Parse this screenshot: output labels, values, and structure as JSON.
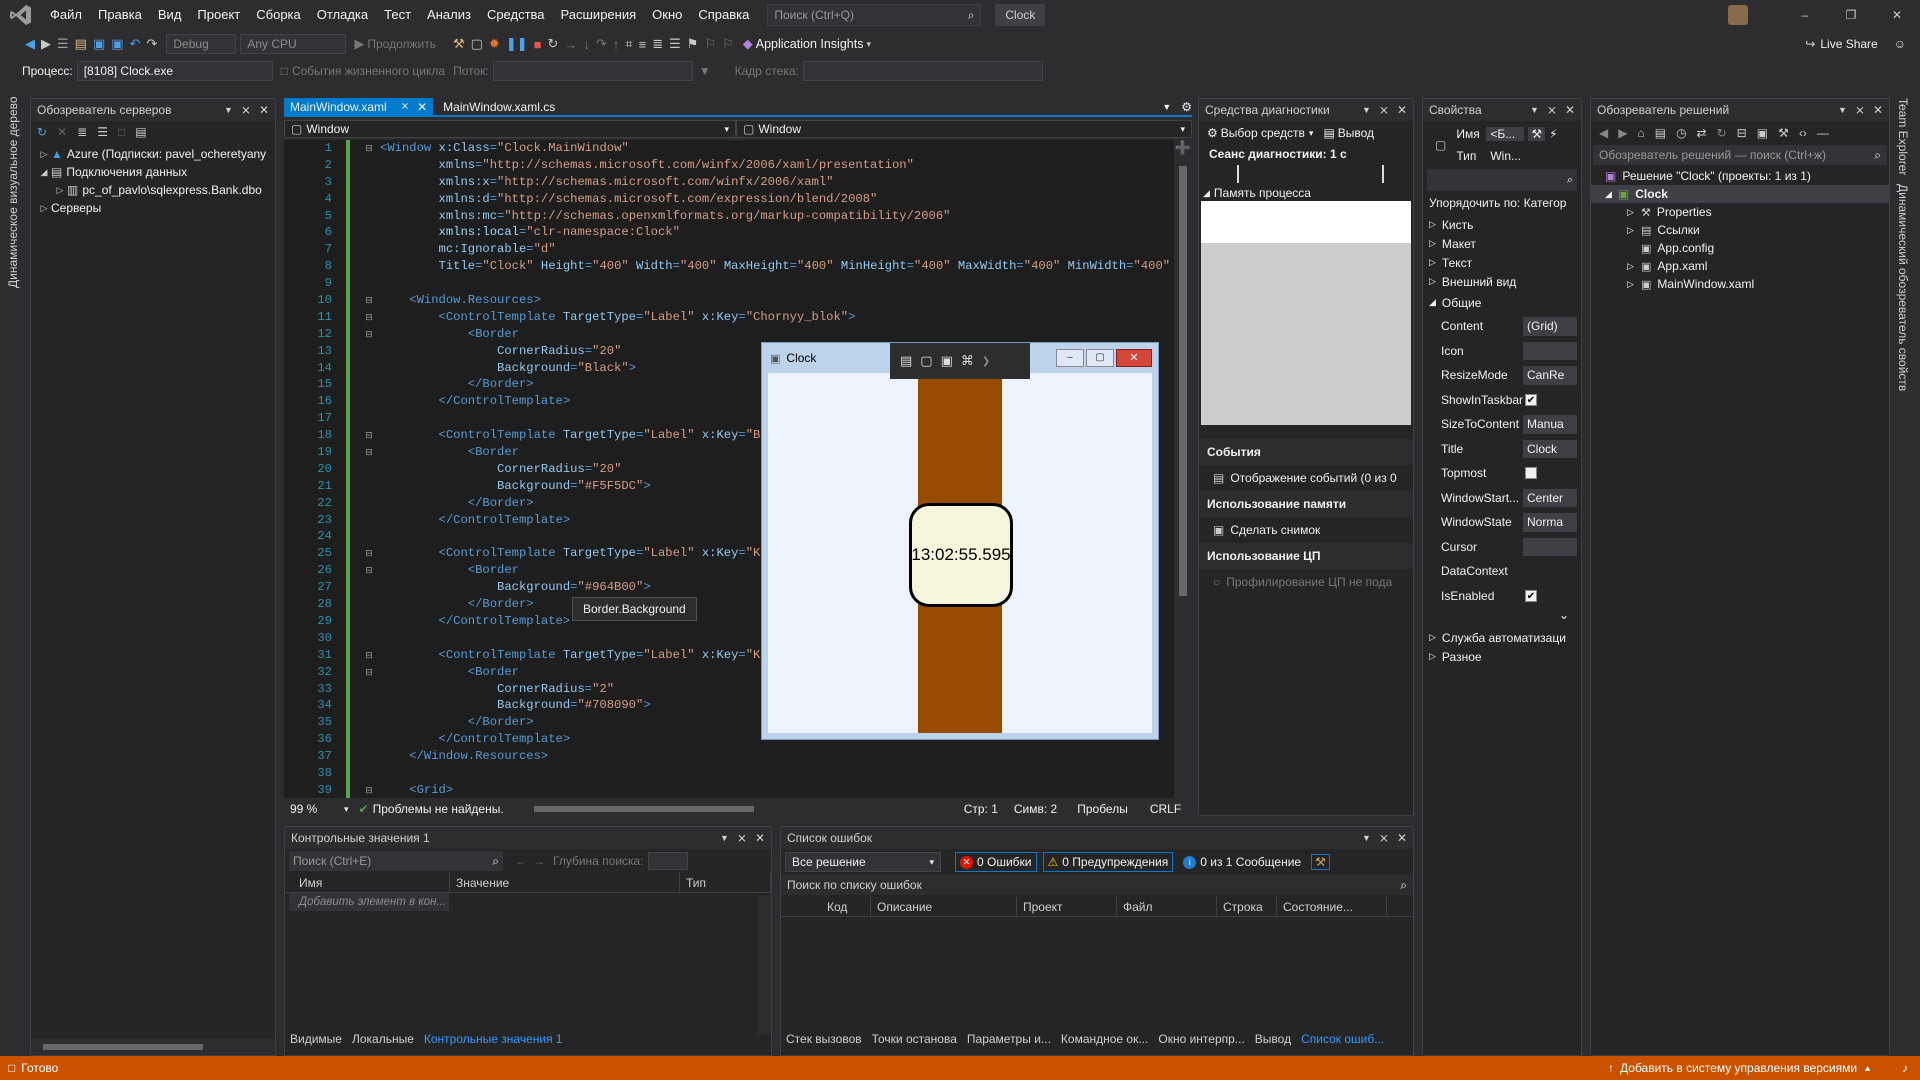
{
  "menu": [
    "Файл",
    "Правка",
    "Вид",
    "Проект",
    "Сборка",
    "Отладка",
    "Тест",
    "Анализ",
    "Средства",
    "Расширения",
    "Окно",
    "Справка"
  ],
  "search_placeholder": "Поиск (Ctrl+Q)",
  "solution_title": "Clock",
  "toolbar": {
    "config": "Debug",
    "platform": "Any CPU",
    "continue": "Продолжить",
    "app_insights": "Application Insights",
    "live_share": "Live Share"
  },
  "debug_bar": {
    "process_label": "Процесс:",
    "process_value": "[8108] Clock.exe",
    "lifecycle": "События жизненного цикла",
    "thread_label": "Поток:",
    "stack_label": "Кадр стека:"
  },
  "left_strip": "Динамическое визуальное дерево",
  "right_strip1": "Team Explorer",
  "right_strip2": "Динамический обозреватель свойств",
  "server_explorer": {
    "title": "Обозреватель серверов",
    "items": [
      {
        "label": "Azure (Подписки: pavel_ocheretyany"
      },
      {
        "label": "Подключения данных"
      },
      {
        "label": "pc_of_pavlo\\sqlexpress.Bank.dbo"
      },
      {
        "label": "Серверы"
      }
    ]
  },
  "editor": {
    "tabs": [
      "MainWindow.xaml",
      "MainWindow.xaml.cs"
    ],
    "nav_left": "Window",
    "nav_right": "Window",
    "zoom": "99 %",
    "no_issues": "Проблемы не найдены.",
    "line": "Стр: 1",
    "col": "Симв: 2",
    "spaces": "Пробелы",
    "crlf": "CRLF",
    "tooltip": "Border.Background"
  },
  "code_lines": [
    [
      [
        "tag",
        "<Window"
      ],
      [
        "attr",
        " x:Class"
      ],
      [
        "tag",
        "="
      ],
      [
        "str",
        "\"Clock.MainWindow\""
      ]
    ],
    [
      [
        "attr",
        "        xmlns"
      ],
      [
        "tag",
        "="
      ],
      [
        "str",
        "\"http://schemas.microsoft.com/winfx/2006/xaml/presentation\""
      ]
    ],
    [
      [
        "attr",
        "        xmlns:x"
      ],
      [
        "tag",
        "="
      ],
      [
        "str",
        "\"http://schemas.microsoft.com/winfx/2006/xaml\""
      ]
    ],
    [
      [
        "attr",
        "        xmlns:d"
      ],
      [
        "tag",
        "="
      ],
      [
        "str",
        "\"http://schemas.microsoft.com/expression/blend/2008\""
      ]
    ],
    [
      [
        "attr",
        "        xmlns:mc"
      ],
      [
        "tag",
        "="
      ],
      [
        "str",
        "\"http://schemas.openxmlformats.org/markup-compatibility/2006\""
      ]
    ],
    [
      [
        "xmlns",
        "        xmlns:local"
      ],
      [
        "tag",
        "="
      ],
      [
        "str",
        "\"clr-namespace:Clock\""
      ]
    ],
    [
      [
        "attr",
        "        mc:Ignorable"
      ],
      [
        "tag",
        "="
      ],
      [
        "str",
        "\"d\""
      ]
    ],
    [
      [
        "attr",
        "        Title"
      ],
      [
        "tag",
        "="
      ],
      [
        "str",
        "\"Clock\""
      ],
      [
        "attr",
        " Height"
      ],
      [
        "tag",
        "="
      ],
      [
        "str",
        "\"400\""
      ],
      [
        "attr",
        " Width"
      ],
      [
        "tag",
        "="
      ],
      [
        "str",
        "\"400\""
      ],
      [
        "attr",
        " MaxHeight"
      ],
      [
        "tag",
        "="
      ],
      [
        "str",
        "\"400\""
      ],
      [
        "attr",
        " MinHeight"
      ],
      [
        "tag",
        "="
      ],
      [
        "str",
        "\"400\""
      ],
      [
        "attr",
        " MaxWidth"
      ],
      [
        "tag",
        "="
      ],
      [
        "str",
        "\"400\""
      ],
      [
        "attr",
        " MinWidth"
      ],
      [
        "tag",
        "="
      ],
      [
        "str",
        "\"400\""
      ],
      [
        "attr",
        " Winc"
      ]
    ],
    [],
    [
      [
        "tag",
        "    <Window.Resources>"
      ]
    ],
    [
      [
        "tag",
        "        <ControlTemplate"
      ],
      [
        "attr",
        " TargetType"
      ],
      [
        "tag",
        "="
      ],
      [
        "str",
        "\"Label\""
      ],
      [
        "attr",
        " x:Key"
      ],
      [
        "tag",
        "="
      ],
      [
        "str",
        "\"Chornyy_blok\""
      ],
      [
        "tag",
        ">"
      ]
    ],
    [
      [
        "tag",
        "            <Border"
      ]
    ],
    [
      [
        "attr",
        "                CornerRadius"
      ],
      [
        "tag",
        "="
      ],
      [
        "str",
        "\"20\""
      ]
    ],
    [
      [
        "attr",
        "                Background"
      ],
      [
        "tag",
        "="
      ],
      [
        "str",
        "\"Black\""
      ],
      [
        "tag",
        ">"
      ]
    ],
    [
      [
        "tag",
        "            </Border>"
      ]
    ],
    [
      [
        "tag",
        "        </ControlTemplate>"
      ]
    ],
    [],
    [
      [
        "tag",
        "        <ControlTemplate"
      ],
      [
        "attr",
        " TargetType"
      ],
      [
        "tag",
        "="
      ],
      [
        "str",
        "\"Label\""
      ],
      [
        "attr",
        " x:Key"
      ],
      [
        "tag",
        "="
      ],
      [
        "str",
        "\"Bely"
      ]
    ],
    [
      [
        "tag",
        "            <Border"
      ]
    ],
    [
      [
        "attr",
        "                CornerRadius"
      ],
      [
        "tag",
        "="
      ],
      [
        "str",
        "\"20\""
      ]
    ],
    [
      [
        "attr",
        "                Background"
      ],
      [
        "tag",
        "="
      ],
      [
        "str",
        "\"#F5F5DC\""
      ],
      [
        "tag",
        ">"
      ]
    ],
    [
      [
        "tag",
        "            </Border>"
      ]
    ],
    [
      [
        "tag",
        "        </ControlTemplate>"
      ]
    ],
    [],
    [
      [
        "tag",
        "        <ControlTemplate"
      ],
      [
        "attr",
        " TargetType"
      ],
      [
        "tag",
        "="
      ],
      [
        "str",
        "\"Label\""
      ],
      [
        "attr",
        " x:Key"
      ],
      [
        "tag",
        "="
      ],
      [
        "str",
        "\"Kor:"
      ]
    ],
    [
      [
        "tag",
        "            <Border"
      ]
    ],
    [
      [
        "attr",
        "                Background"
      ],
      [
        "tag",
        "="
      ],
      [
        "str",
        "\"#964B00\""
      ],
      [
        "tag",
        ">"
      ]
    ],
    [
      [
        "tag",
        "            </Border>"
      ]
    ],
    [
      [
        "tag",
        "        </ControlTemplate>"
      ]
    ],
    [],
    [
      [
        "tag",
        "        <ControlTemplate"
      ],
      [
        "attr",
        " TargetType"
      ],
      [
        "tag",
        "="
      ],
      [
        "str",
        "\"Label\""
      ],
      [
        "attr",
        " x:Key"
      ],
      [
        "tag",
        "="
      ],
      [
        "str",
        "\"Knop"
      ]
    ],
    [
      [
        "tag",
        "            <Border"
      ]
    ],
    [
      [
        "attr",
        "                CornerRadius"
      ],
      [
        "tag",
        "="
      ],
      [
        "str",
        "\"2\""
      ]
    ],
    [
      [
        "attr",
        "                Background"
      ],
      [
        "tag",
        "="
      ],
      [
        "str",
        "\"#708090\""
      ],
      [
        "tag",
        ">"
      ]
    ],
    [
      [
        "tag",
        "            </Border>"
      ]
    ],
    [
      [
        "tag",
        "        </ControlTemplate>"
      ]
    ],
    [
      [
        "tag",
        "    </Window.Resources>"
      ]
    ],
    [],
    [
      [
        "tag",
        "    <Grid>"
      ]
    ]
  ],
  "line_numbers": [
    "1",
    "2",
    "3",
    "4",
    "5",
    "6",
    "7",
    "8",
    "9",
    "10",
    "11",
    "12",
    "13",
    "14",
    "15",
    "16",
    "17",
    "18",
    "19",
    "20",
    "21",
    "22",
    "23",
    "24",
    "25",
    "26",
    "27",
    "28",
    "29",
    "30",
    "31",
    "32",
    "33",
    "34",
    "35",
    "36",
    "37",
    "38",
    "39"
  ],
  "app_window": {
    "title": "Clock",
    "time": "13:02:55.595",
    "strap_color": "#964B00",
    "face_color": "#F5F5DC"
  },
  "diagnostics": {
    "title": "Средства диагностики",
    "select_tools": "Выбор средств",
    "output": "Вывод",
    "session": "Сеанс диагностики: 1 с",
    "memory_header": "Память процесса",
    "events_h": "События",
    "events_item": "Отображение событий (0 из 0",
    "memory_h": "Использование памяти",
    "snapshot": "Сделать снимок",
    "cpu_h": "Использование ЦП",
    "cpu_item": "Профилирование ЦП не пода"
  },
  "properties": {
    "title": "Свойства",
    "name_label": "Имя",
    "name_value": "<Б...",
    "type_label": "Тип",
    "type_value": "Win...",
    "sort": "Упорядочить по: Категор",
    "categories": [
      "Кисть",
      "Макет",
      "Текст",
      "Внешний вид"
    ],
    "common": "Общие",
    "rows": [
      {
        "name": "Content",
        "value": "(Grid)"
      },
      {
        "name": "Icon",
        "value": ""
      },
      {
        "name": "ResizeMode",
        "value": "CanRe"
      },
      {
        "name": "ShowInTaskbar",
        "value": ""
      },
      {
        "name": "SizeToContent",
        "value": "Manua"
      },
      {
        "name": "Title",
        "value": "Clock"
      },
      {
        "name": "Topmost",
        "value": ""
      },
      {
        "name": "WindowStart...",
        "value": "Center"
      },
      {
        "name": "WindowState",
        "value": "Norma"
      },
      {
        "name": "Cursor",
        "value": ""
      },
      {
        "name": "DataContext",
        "value": ""
      },
      {
        "name": "IsEnabled",
        "value": ""
      }
    ],
    "after": [
      "Служба автоматизаци",
      "Разное"
    ]
  },
  "solution_explorer": {
    "title": "Обозреватель решений",
    "search": "Обозреватель решений — поиск (Ctrl+ж)",
    "solution": "Решение \"Clock\" (проекты: 1 из 1)",
    "project": "Clock",
    "items": [
      "Properties",
      "Ссылки",
      "App.config",
      "App.xaml",
      "MainWindow.xaml"
    ]
  },
  "watch": {
    "title": "Контрольные значения 1",
    "search": "Поиск (Ctrl+E)",
    "depth": "Глубина поиска:",
    "cols": [
      "Имя",
      "Значение",
      "Тип"
    ],
    "add": "Добавить элемент в кон...",
    "tabs": [
      "Видимые",
      "Локальные",
      "Контрольные значения 1"
    ]
  },
  "errors": {
    "title": "Список ошибок",
    "scope": "Все решение",
    "errors": "0 Ошибки",
    "warnings": "0 Предупреждения",
    "messages": "0 из 1 Сообщение",
    "search": "Поиск по списку ошибок",
    "cols": [
      "Код",
      "Описание",
      "Проект",
      "Файл",
      "Строка",
      "Состояние..."
    ],
    "tabs": [
      "Стек вызовов",
      "Точки останова",
      "Параметры и...",
      "Командное ок...",
      "Окно интерпр...",
      "Вывод",
      "Список ошиб..."
    ]
  },
  "status": {
    "ready": "Готово",
    "source_control": "Добавить в систему управления версиями",
    "color": "#ca5100"
  }
}
